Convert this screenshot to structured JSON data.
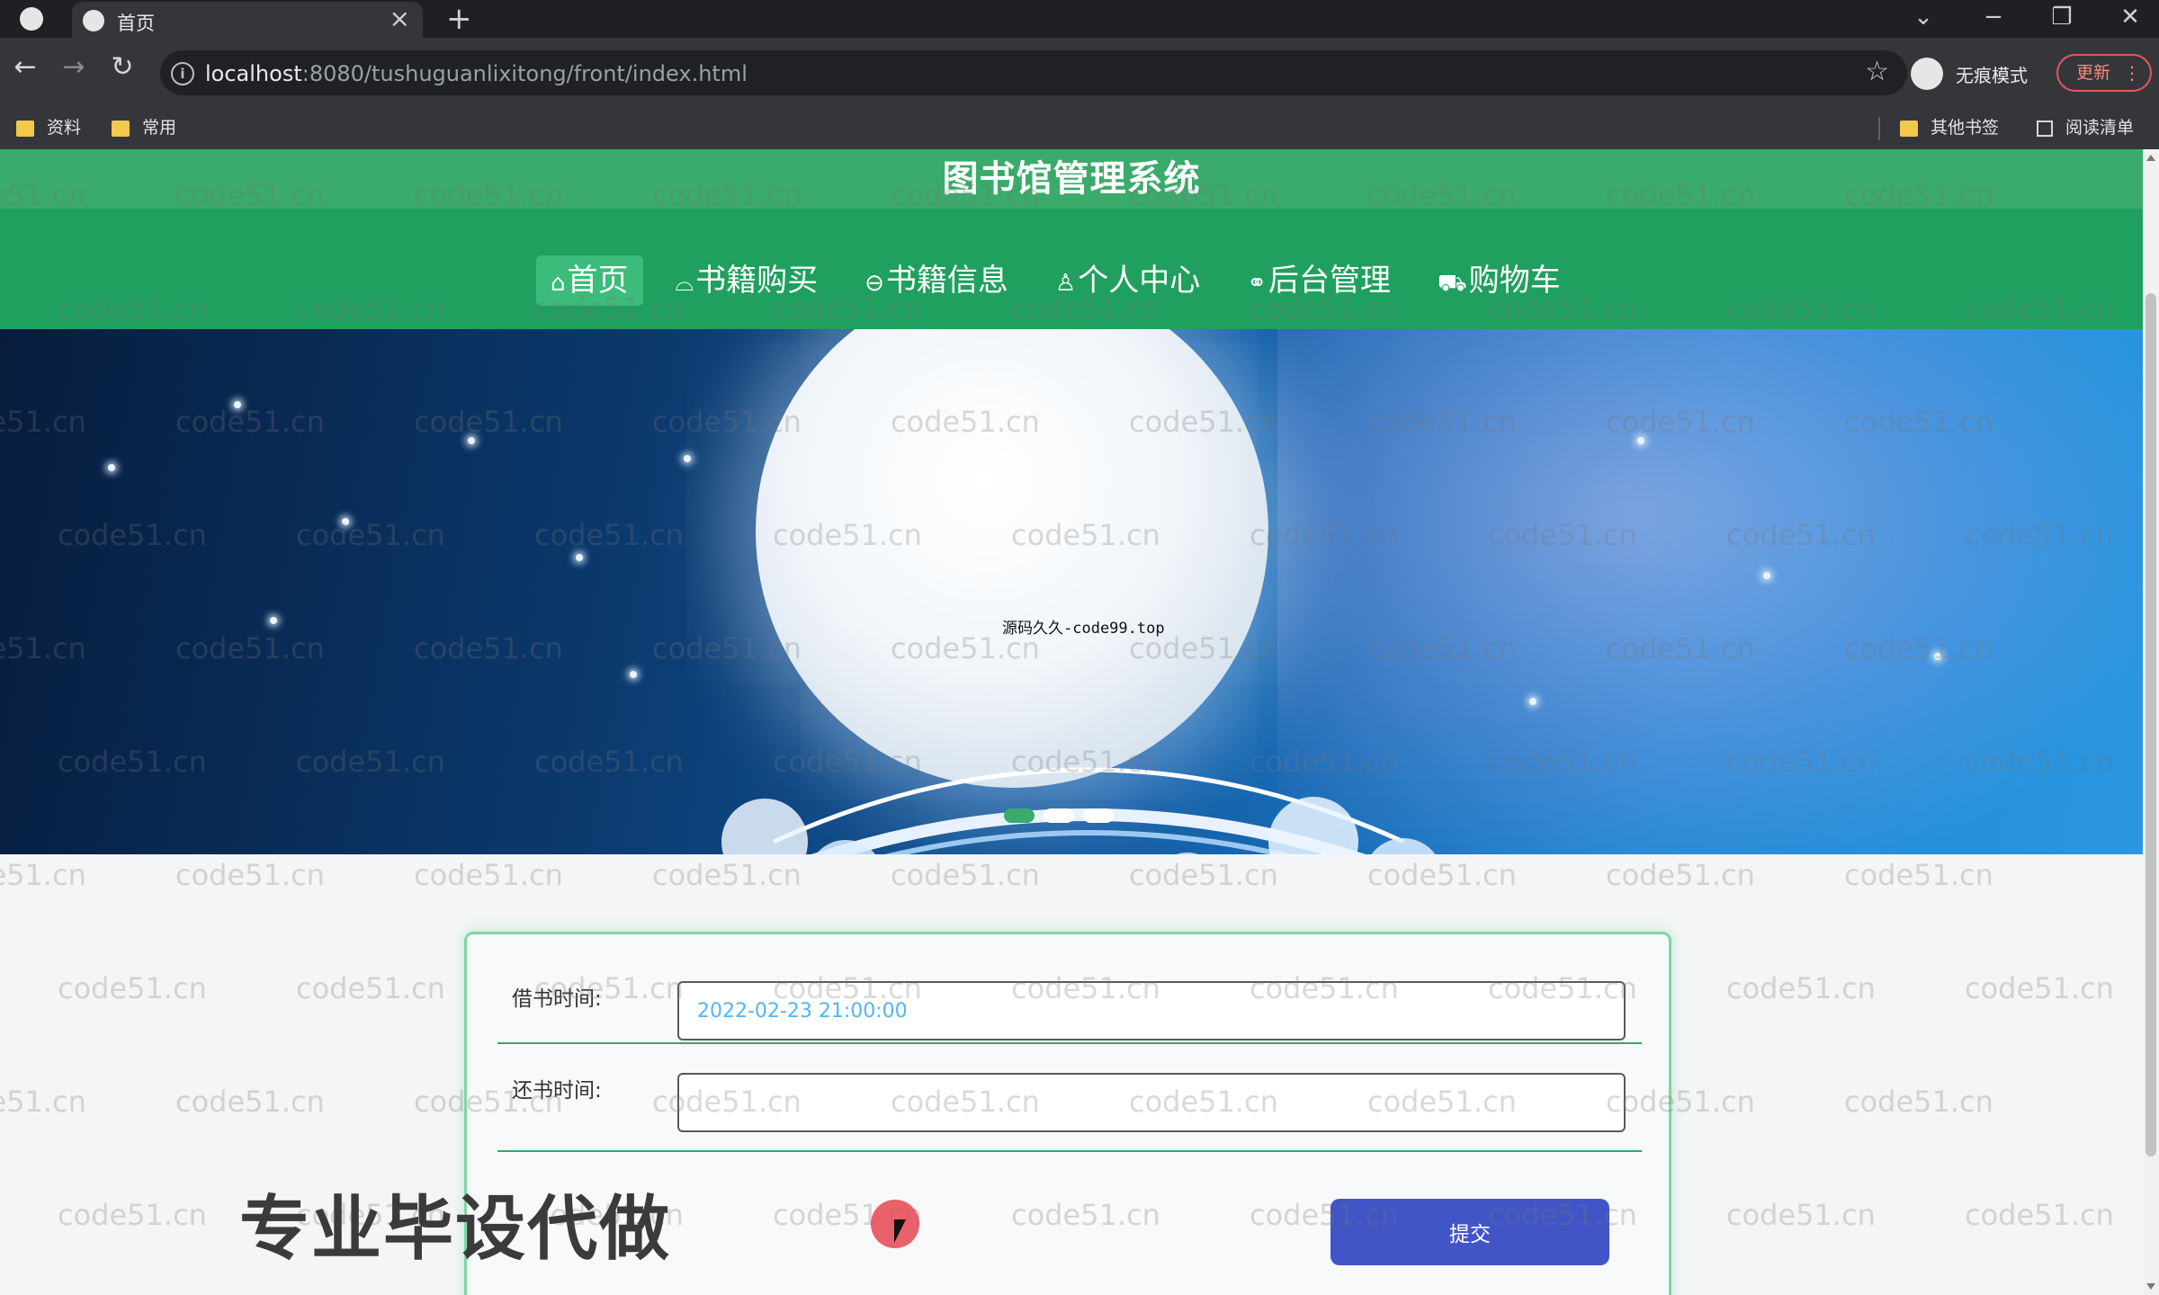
{
  "browser": {
    "tab_title": "首页",
    "url_host": "localhost",
    "url_rest": ":8080/tushuguanlixitong/front/index.html",
    "incognito_label": "无痕模式",
    "update_label": "更新",
    "bookmarks": [
      "资料",
      "常用"
    ],
    "bookmarks_right": [
      "其他书签",
      "阅读清单"
    ],
    "controls": {
      "close_tab": "×",
      "new_tab": "+",
      "back": "←",
      "forward": "→",
      "reload": "↻",
      "star": "☆",
      "dropdown": "⌄",
      "minimize": "−",
      "restore": "❐",
      "close_window": "✕",
      "info": "i"
    }
  },
  "site": {
    "title": "图书馆管理系统",
    "nav": [
      {
        "label": "首页",
        "icon": "⌂"
      },
      {
        "label": "书籍购买",
        "icon": "⌓"
      },
      {
        "label": "书籍信息",
        "icon": "⊖"
      },
      {
        "label": "个人中心",
        "icon": "♙"
      },
      {
        "label": "后台管理",
        "icon": "⚭"
      },
      {
        "label": "购物车",
        "icon": "⛟"
      }
    ],
    "banner_caption": "源码久久-code99.top",
    "carousel": {
      "count": 3,
      "active": 0
    }
  },
  "form": {
    "borrow_label": "借书时间:",
    "borrow_value": "2022-02-23 21:00:00",
    "return_label": "还书时间:",
    "return_value": "",
    "submit_label": "提交"
  },
  "overlay": {
    "promo": "专业毕设代做",
    "watermark": "code51.cn"
  },
  "colors": {
    "title_bar": "#3aab6a",
    "nav_bar": "#20a05e",
    "nav_active": "#3cbc7a",
    "submit": "#4255c7",
    "card_border": "#7fd6a6"
  }
}
